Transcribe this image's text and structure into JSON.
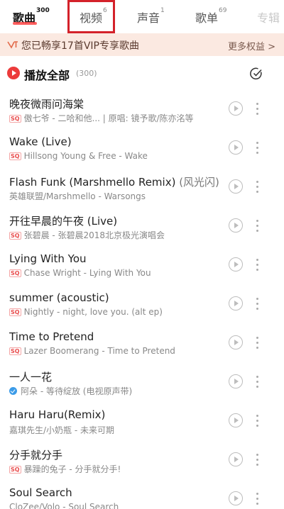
{
  "tabs": [
    {
      "label": "歌曲",
      "count": "300"
    },
    {
      "label": "视频",
      "count": "6"
    },
    {
      "label": "声音",
      "count": "1"
    },
    {
      "label": "歌单",
      "count": "69"
    },
    {
      "label": "专辑",
      "count": ""
    }
  ],
  "vip_banner": {
    "text": "您已畅享17首VIP专享歌曲",
    "more": "更多权益 >"
  },
  "play_all": {
    "label": "播放全部",
    "count": "(300)"
  },
  "songs": [
    {
      "title": "晚夜微雨问海棠",
      "title_extra": "",
      "badge": "sq",
      "subtitle": "傲七爷 - 二哈和他... | 原唱: 镜予歌/陈亦洺等"
    },
    {
      "title": "Wake (Live)",
      "title_extra": "",
      "badge": "sq",
      "subtitle": "Hillsong Young & Free - Wake"
    },
    {
      "title": "Flash Funk (Marshmello Remix)",
      "title_extra": " (风光闪)",
      "badge": "",
      "subtitle": "英雄联盟/Marshmello - Warsongs"
    },
    {
      "title": "开往早晨的午夜 (Live)",
      "title_extra": "",
      "badge": "sq",
      "subtitle": "张碧晨 - 张碧晨2018北京极光演唱会"
    },
    {
      "title": "Lying With You",
      "title_extra": "",
      "badge": "sq",
      "subtitle": "Chase Wright - Lying With You"
    },
    {
      "title": "summer (acoustic)",
      "title_extra": "",
      "badge": "sq",
      "subtitle": "Nightly - night, love you. (alt ep)"
    },
    {
      "title": "Time to Pretend",
      "title_extra": "",
      "badge": "sq",
      "subtitle": "Lazer Boomerang - Time to Pretend"
    },
    {
      "title": "一人一花",
      "title_extra": "",
      "badge": "verified",
      "subtitle": "阿朵 - 等待绽放 (电视原声带)"
    },
    {
      "title": "Haru Haru(Remix)",
      "title_extra": "",
      "badge": "",
      "subtitle": "嘉琪先生/小奶瓶 - 未来可期"
    },
    {
      "title": "分手就分手",
      "title_extra": "",
      "badge": "sq",
      "subtitle": "暴躁的兔子 - 分手就分手!"
    },
    {
      "title": "Soul Search",
      "title_extra": "",
      "badge": "",
      "subtitle": "CloZee/Volo - Soul Search"
    }
  ],
  "badge_text": {
    "sq": "SQ"
  },
  "icons": {
    "vip": "vip-icon",
    "play_all": "play-circle-icon",
    "multi_select": "checkmark-circle-icon",
    "song_mv": "play-circle-outline-icon",
    "song_more": "more-vertical-icon"
  },
  "colors": {
    "accent": "#ec3b3b",
    "vip_banner_bg": "#fbe9e1",
    "highlight_box": "#d4222a"
  }
}
